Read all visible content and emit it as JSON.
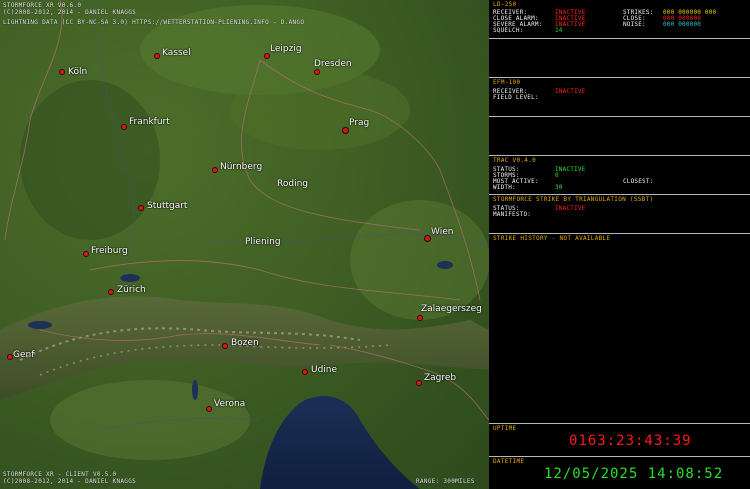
{
  "map": {
    "title_lines": [
      "STORMFORCE XR V0.6.0",
      "(C)2008-2012, 2014 - DANIEL KNAGGS",
      "LIGHTNING DATA (CC BY-NC-SA 3.0) HTTPS://WETTERSTATION-PLIENING.INFO - D.ANGO"
    ],
    "footer_lines": [
      "STORMFORCE XR - CLIENT V0.5.0",
      "(C)2008-2012, 2014 - DANIEL KNAGGS"
    ],
    "range_text": "RANGE: 300MILES",
    "cities": [
      {
        "name": "Köln",
        "capital": false
      },
      {
        "name": "Kassel",
        "capital": false
      },
      {
        "name": "Leipzig",
        "capital": false
      },
      {
        "name": "Dresden",
        "capital": false
      },
      {
        "name": "Frankfurt",
        "capital": false
      },
      {
        "name": "Prag",
        "capital": true
      },
      {
        "name": "Nürnberg",
        "capital": false
      },
      {
        "name": "Roding",
        "capital": false
      },
      {
        "name": "Stuttgart",
        "capital": false
      },
      {
        "name": "Wien",
        "capital": true
      },
      {
        "name": "Pliening",
        "capital": false
      },
      {
        "name": "Freiburg",
        "capital": false
      },
      {
        "name": "Zürich",
        "capital": false
      },
      {
        "name": "Zalaegerszeg",
        "capital": false
      },
      {
        "name": "Bozen",
        "capital": false
      },
      {
        "name": "Genf",
        "capital": false
      },
      {
        "name": "Udine",
        "capital": false
      },
      {
        "name": "Zagreb",
        "capital": false
      },
      {
        "name": "Verona",
        "capital": false
      }
    ]
  },
  "colors": {
    "accent": "#e8a800",
    "inactive": "#ff2020",
    "active": "#28e028",
    "border": "#b8b8b8"
  },
  "panel": {
    "ld": {
      "title": "LD-250",
      "receiver_label": "RECEIVER:",
      "receiver_value": "INACTIVE",
      "close_alarm_label": "CLOSE ALARM:",
      "close_alarm_value": "INACTIVE",
      "severe_alarm_label": "SEVERE ALARM:",
      "severe_alarm_value": "INACTIVE",
      "squelch_label": "SQUELCH:",
      "squelch_value": "14",
      "strikes_label": "STRIKES:",
      "strikes_value": "000 000000 000",
      "close_label": "CLOSE:",
      "close_value": "000 000000",
      "noise_label": "NOISE:",
      "noise_value": "000 000000"
    },
    "efm": {
      "title": "EFM-100",
      "receiver_label": "RECEIVER:",
      "receiver_value": "INACTIVE",
      "field_level_label": "FIELD LEVEL:"
    },
    "trac": {
      "title": "TRAC V0.4.0",
      "status_label": "STATUS:",
      "status_value": "INACTIVE",
      "storms_label": "STORMS:",
      "storms_value": "0",
      "most_active_label": "MOST ACTIVE:",
      "closest_label": "CLOSEST:",
      "width_label": "WIDTH:",
      "width_value": "30"
    },
    "ssbt": {
      "title": "STORMFORCE STRIKE BY TRIANGULATION (SSBT)",
      "status_label": "STATUS:",
      "status_value": "INACTIVE",
      "manifesto_label": "MANIFESTO:"
    },
    "history": {
      "title": "STRIKE HISTORY - NOT AVAILABLE"
    },
    "uptime": {
      "title": "UPTIME",
      "value": "0163:23:43:39"
    },
    "datetime": {
      "title": "DATETIME",
      "value": "12/05/2025 14:08:52"
    }
  }
}
